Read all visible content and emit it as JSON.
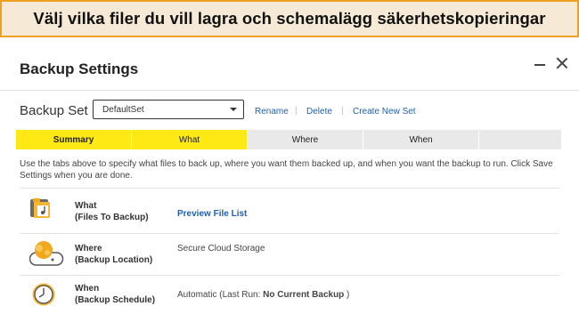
{
  "banner": {
    "text": "Välj vilka filer du vill lagra och schemalägg säkerhetskopieringar"
  },
  "window": {
    "title": "Backup Settings"
  },
  "backup_set": {
    "label": "Backup Set",
    "selected": "DefaultSet",
    "actions": {
      "rename": "Rename",
      "delete": "Delete",
      "create": "Create New Set"
    }
  },
  "tabs": [
    {
      "label": "Summary",
      "active": true
    },
    {
      "label": "What"
    },
    {
      "label": "Where"
    },
    {
      "label": "When"
    }
  ],
  "description": "Use the tabs above to specify what files to back up, where you want them backed up, and when you want the backup to run. Click Save Settings when you are done.",
  "rows": {
    "what": {
      "title": "What",
      "subtitle": "(Files To Backup)",
      "link": "Preview File List",
      "icon": "files-folder-icon"
    },
    "where": {
      "title": "Where",
      "subtitle": "(Backup Location)",
      "value": "Secure Cloud Storage",
      "icon": "cloud-storage-icon"
    },
    "when": {
      "title": "When",
      "subtitle": "(Backup Schedule)",
      "value_prefix": "Automatic (Last Run: ",
      "value_bold": "No Current Backup",
      "value_suffix": " )",
      "icon": "clock-icon"
    }
  },
  "colors": {
    "accent_yellow": "#ffe914",
    "banner_border": "#f0a020",
    "link_blue": "#1f5fae"
  }
}
